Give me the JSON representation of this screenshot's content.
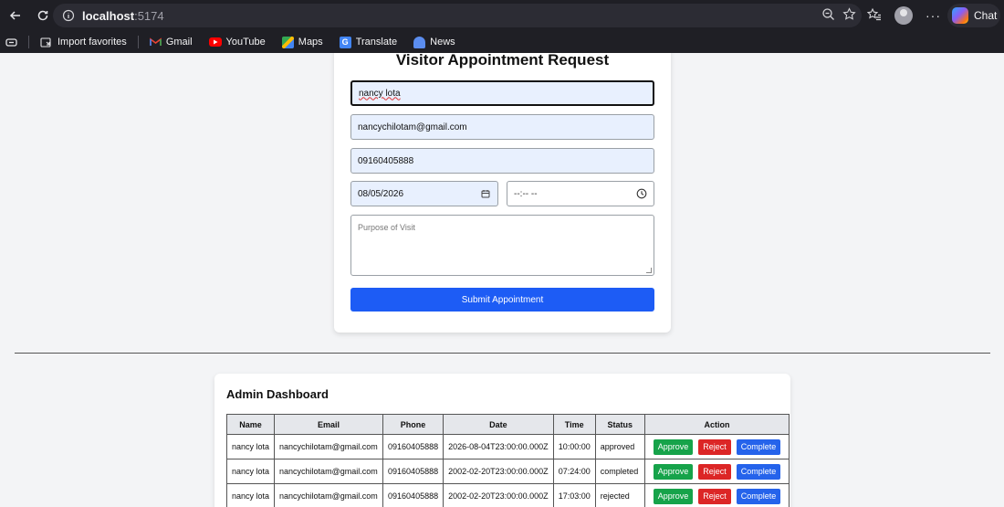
{
  "browser": {
    "url_host": "localhost",
    "url_port": ":5174",
    "chat_label": "Chat",
    "bookmarks": [
      {
        "label": "Import favorites",
        "icon": "import-icon"
      },
      {
        "label": "Gmail",
        "icon": "gmail-icon"
      },
      {
        "label": "YouTube",
        "icon": "youtube-icon"
      },
      {
        "label": "Maps",
        "icon": "maps-icon"
      },
      {
        "label": "Translate",
        "icon": "translate-icon"
      },
      {
        "label": "News",
        "icon": "news-icon"
      }
    ]
  },
  "form": {
    "title": "Visitor Appointment Request",
    "name_value": "nancy lota",
    "email_value": "nancychilotam@gmail.com",
    "phone_value": "09160405888",
    "date_value": "08/05/2026",
    "time_value": "--:-- --",
    "purpose_placeholder": "Purpose of Visit",
    "submit_label": "Submit Appointment"
  },
  "dashboard": {
    "title": "Admin Dashboard",
    "columns": [
      "Name",
      "Email",
      "Phone",
      "Date",
      "Time",
      "Status",
      "Action"
    ],
    "actions": {
      "approve": "Approve",
      "reject": "Reject",
      "complete": "Complete"
    },
    "rows": [
      {
        "name": "nancy lota",
        "email": "nancychilotam@gmail.com",
        "phone": "09160405888",
        "date": "2026-08-04T23:00:00.000Z",
        "time": "10:00:00",
        "status": "approved"
      },
      {
        "name": "nancy lota",
        "email": "nancychilotam@gmail.com",
        "phone": "09160405888",
        "date": "2002-02-20T23:00:00.000Z",
        "time": "07:24:00",
        "status": "completed"
      },
      {
        "name": "nancy lota",
        "email": "nancychilotam@gmail.com",
        "phone": "09160405888",
        "date": "2002-02-20T23:00:00.000Z",
        "time": "17:03:00",
        "status": "rejected"
      }
    ]
  },
  "colors": {
    "primary": "#1d5cf5",
    "approve": "#16a34a",
    "reject": "#dc2626",
    "complete": "#2563eb"
  }
}
